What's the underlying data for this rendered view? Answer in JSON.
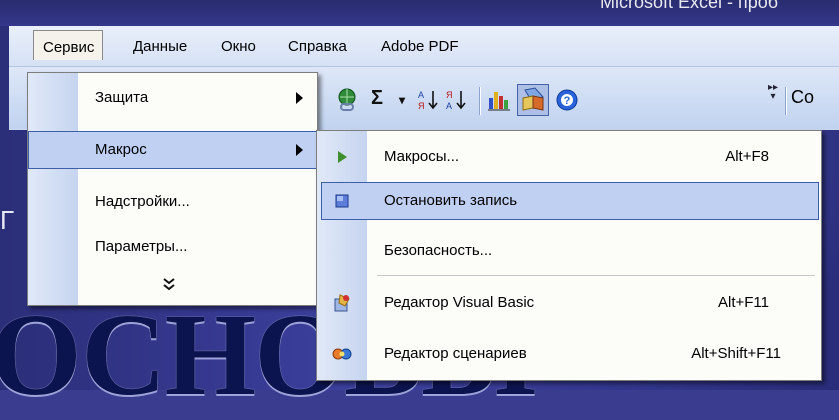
{
  "slide": {
    "title_fragment": "Microsoft Excel - проб",
    "side_letter": "Г",
    "big_word": "ОСНОВЫ"
  },
  "menubar": {
    "items": [
      {
        "label": "Сервис",
        "open": true
      },
      {
        "label": "Данные"
      },
      {
        "label": "Окно"
      },
      {
        "label": "Справка"
      },
      {
        "label": "Adobe PDF"
      }
    ]
  },
  "toolbar": {
    "sigma": "Σ",
    "sigma_dropdown": "▾",
    "sort_asc_icon": "sort-ascending-icon",
    "sort_desc_icon": "sort-descending-icon",
    "overflow": "▸▸",
    "cut_label": "Co"
  },
  "service_menu": {
    "items": [
      {
        "label": "Защита",
        "submenu": true
      },
      {
        "label": "Макрос",
        "submenu": true,
        "highlighted": true
      },
      {
        "label": "Надстройки..."
      },
      {
        "label": "Параметры..."
      }
    ],
    "expand": "»"
  },
  "macro_menu": {
    "items": [
      {
        "label": "Макросы...",
        "shortcut": "Alt+F8",
        "icon": "play-icon"
      },
      {
        "label": "Остановить запись",
        "shortcut": "",
        "icon": "stop-icon",
        "highlighted": true
      },
      {
        "label": "Безопасность...",
        "shortcut": ""
      },
      {
        "label": "Редактор Visual Basic",
        "shortcut": "Alt+F11",
        "icon": "vba-editor-icon"
      },
      {
        "label": "Редактор сценариев",
        "shortcut": "Alt+Shift+F11",
        "icon": "script-editor-icon"
      }
    ]
  },
  "colors": {
    "menu_highlight": "#c0d0f2",
    "slide_bg": "#3a3d8f",
    "menubar_bg": "#e9effa"
  }
}
